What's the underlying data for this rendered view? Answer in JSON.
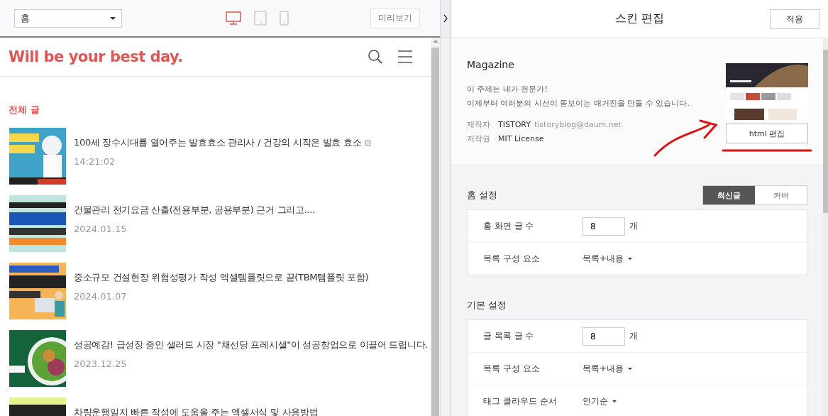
{
  "preview_toolbar": {
    "page_select": "홈",
    "devices": [
      {
        "kind": "desktop",
        "selected": true
      },
      {
        "kind": "tablet",
        "selected": false
      },
      {
        "kind": "mobile",
        "selected": false
      }
    ],
    "preview_button": "미리보기"
  },
  "blog": {
    "title": "Will be your best day.",
    "section_title": "전체 글",
    "posts": [
      {
        "title": "100세 장수시대를 열어주는 발효효소 관리사 / 건강의 시작은 발효 효소",
        "date": "14:21:02",
        "new": true
      },
      {
        "title": "건물관리 전기요금 산출(전용부분, 공용부분) 근거 그리고....",
        "date": "2024.01.15",
        "new": false
      },
      {
        "title": "중소규모 건설현장 위험성평가 작성 엑셀템플릿으로 끝(TBM템플릿 포함)",
        "date": "2024.01.07",
        "new": false
      },
      {
        "title": "성공예감! 급성장 중인 샐러드 시장 \"채선당 프레시샐\"이 성공창업으로 이끌어 드립니다.",
        "date": "2023.12.25",
        "new": false
      },
      {
        "title": "차량운행일지 빠른 작성에 도움을 주는 엑셀서식 및 사용방법",
        "new": false
      }
    ]
  },
  "skin_panel": {
    "title": "스킨 편집",
    "apply_button": "적용",
    "skin": {
      "name": "Magazine",
      "description": [
        "이 주제는 내가 전문가!",
        "이제부터 여러분의 시선이 돋보이는 매거진을 만들 수 있습니다."
      ],
      "meta": [
        {
          "label": "제작자",
          "value": "TISTORY",
          "extra": "tistoryblog@daum.net"
        },
        {
          "label": "저작권",
          "value": "MIT License"
        }
      ],
      "html_edit_button": "html 편집"
    },
    "sections": [
      {
        "title": "홈 설정",
        "toggle": [
          {
            "label": "최신글",
            "selected": true
          },
          {
            "label": "커버",
            "selected": false
          }
        ],
        "rows": [
          {
            "kind": "number",
            "label": "홈 화면 글 수",
            "value": "8",
            "unit": "개"
          },
          {
            "kind": "select",
            "label": "목록 구성 요소",
            "value": "목록+내용"
          }
        ]
      },
      {
        "title": "기본 설정",
        "rows": [
          {
            "kind": "number",
            "label": "글 목록 글 수",
            "value": "8",
            "unit": "개"
          },
          {
            "kind": "select",
            "label": "목록 구성 요소",
            "value": "목록+내용"
          },
          {
            "kind": "select",
            "label": "태그 클라우드 순서",
            "value": "인기순"
          }
        ]
      }
    ]
  }
}
